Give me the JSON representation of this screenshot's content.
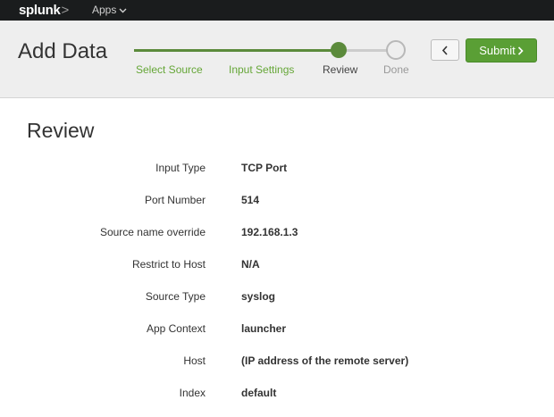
{
  "topbar": {
    "logo": "splunk",
    "logo_chevron": ">",
    "apps_label": "Apps"
  },
  "header": {
    "title": "Add Data",
    "steps": [
      {
        "label": "Select Source",
        "state": "done"
      },
      {
        "label": "Input Settings",
        "state": "done"
      },
      {
        "label": "Review",
        "state": "current"
      },
      {
        "label": "Done",
        "state": "todo"
      }
    ],
    "back_icon": "chevron-left-icon",
    "submit_label": "Submit"
  },
  "review": {
    "title": "Review",
    "rows": [
      {
        "label": "Input Type",
        "value": "TCP Port"
      },
      {
        "label": "Port Number",
        "value": "514"
      },
      {
        "label": "Source name override",
        "value": "192.168.1.3"
      },
      {
        "label": "Restrict to Host",
        "value": "N/A"
      },
      {
        "label": "Source Type",
        "value": "syslog"
      },
      {
        "label": "App Context",
        "value": "launcher"
      },
      {
        "label": "Host",
        "value": "(IP address of the remote server)"
      },
      {
        "label": "Index",
        "value": "default"
      }
    ]
  },
  "colors": {
    "topbar_bg": "#1a1c1d",
    "accent_green": "#5a9f35",
    "step_done_text": "#65a637",
    "header_bg": "#eeeeee"
  }
}
